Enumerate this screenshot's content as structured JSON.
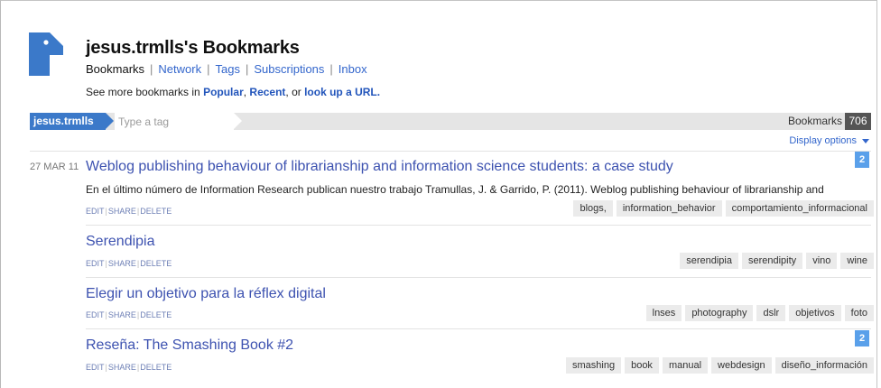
{
  "header": {
    "title": "jesus.trmlls's Bookmarks",
    "nav": [
      "Bookmarks",
      "Network",
      "Tags",
      "Subscriptions",
      "Inbox"
    ],
    "see_more": {
      "prefix": "See more bookmarks in ",
      "popular": "Popular",
      "comma": ", ",
      "recent": "Recent",
      "or": ", or ",
      "lookup": "look up a URL."
    }
  },
  "tagbar": {
    "user": "jesus.trmlls",
    "tag_placeholder": "Type a tag",
    "bookmarks_label": "Bookmarks",
    "bookmarks_count": "706"
  },
  "display_options": "Display options",
  "actions": {
    "edit": "EDIT",
    "share": "SHARE",
    "delete": "DELETE",
    "sep": "|"
  },
  "bookmarks": [
    {
      "date": "27 MAR 11",
      "title": "Weblog publishing behaviour of librarianship and information science students: a case study",
      "description": "En el último número de Information Research publican nuestro trabajo Tramullas, J. & Garrido, P. (2011). Weblog publishing behaviour of librarianship and",
      "tags": [
        "blogs,",
        "information_behavior",
        "comportamiento_informacional"
      ],
      "count": "2"
    },
    {
      "title": "Serendipia",
      "tags": [
        "serendipia",
        "serendipity",
        "vino",
        "wine"
      ]
    },
    {
      "title": "Elegir un objetivo para la réflex digital",
      "tags": [
        "lnses",
        "photography",
        "dslr",
        "objetivos",
        "foto"
      ]
    },
    {
      "title": "Reseña: The Smashing Book #2",
      "tags": [
        "smashing",
        "book",
        "manual",
        "webdesign",
        "diseño_información"
      ],
      "count": "2"
    }
  ],
  "colors": {
    "brand_blue": "#3b79c9",
    "link": "#3366cc",
    "title": "#3d52b0",
    "badge": "#5aa0ea"
  }
}
